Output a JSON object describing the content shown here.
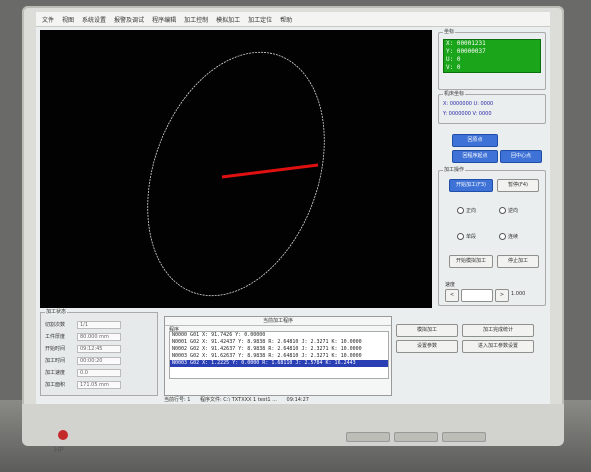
{
  "menu": [
    "文件",
    "视图",
    "系统设置",
    "报警及调试",
    "程序编辑",
    "加工控制",
    "模拟加工",
    "加工定位",
    "帮助"
  ],
  "coords": {
    "group_title": "坐标",
    "x": "X: 00001231",
    "y": "Y: 00000037",
    "u": "U: 0",
    "v": "V: 0"
  },
  "machine": {
    "group_title": "机床坐标",
    "row1": "X: 0000000  U: 0000",
    "row2": "Y: 0000000  V: 0000"
  },
  "buttons": {
    "btn1": "回原点",
    "btn2": "回程序起点",
    "btn3": "回中心点",
    "process_group": "加工操作",
    "start": "开始加工(F3)",
    "pause": "暂停(F4)",
    "opt_a": "正向",
    "opt_b": "逆向",
    "opt_c": "单段",
    "opt_d": "连续",
    "sim": "开始模拟加工",
    "stop": "停止加工",
    "speed_group": "速度",
    "speed_value": "1.000",
    "b_left1": "模拟加工",
    "b_right1": "加工完成统计",
    "b_left2": "设置参数",
    "b_right2": "进入加工参数设置"
  },
  "info": {
    "group_title": "加工状态",
    "labels": [
      "切割次数",
      "工件厚度",
      "开始时间",
      "加工时间",
      "加工速度",
      "加工面积"
    ],
    "values": [
      "1/1",
      "80.000 mm",
      "09:12:45",
      "00:00:20",
      "0.0",
      "171.05 mm"
    ]
  },
  "code": {
    "title": "当前加工程序",
    "header": "程序",
    "lines": [
      "N0000 G01 X: 91.7426 Y: 0.00000",
      "N0001 G02 X: 91.42437 Y: 8.9838 R: 2.64810 J: 2.3271 K: 10.0000",
      "N0002 G02 X: 91.42637 Y: 8.9838 R: 2.64810 J: 2.3271 K: 10.0000",
      "N0003 G02 X: 91.62637 Y: 8.9838 R: 2.64810 J: 2.3271 K: 10.0000",
      "N0003 G02 X: 1.2225 Y: 0.0000 R: 1.68110 J: 2.5784 K: 16.2443"
    ],
    "status_left": "当前行号: 1",
    "status_mid": "程序文件:",
    "status_right": "C:\\ TXTXXX 1 test1 ...",
    "time": "09:14:27"
  }
}
